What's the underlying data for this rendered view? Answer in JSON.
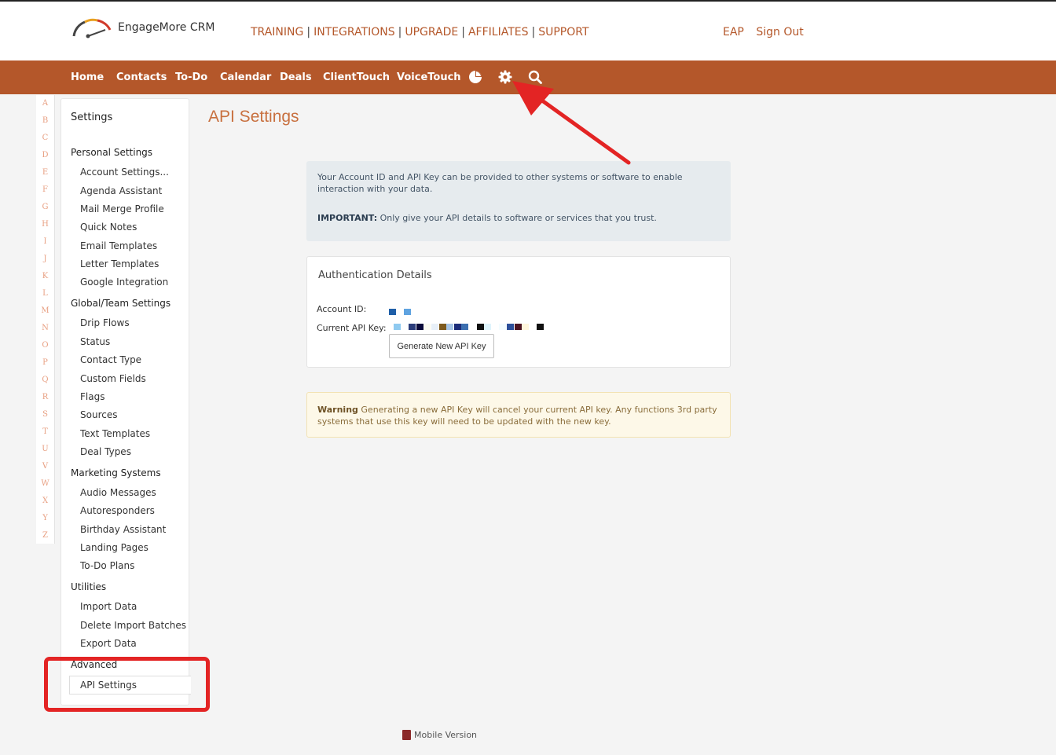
{
  "brand": {
    "name": "EngageMore CRM",
    "logo_icon": "speedometer-logo-icon"
  },
  "top_links": [
    "TRAINING",
    "INTEGRATIONS",
    "UPGRADE",
    "AFFILIATES",
    "SUPPORT"
  ],
  "user": {
    "initials": "EAP",
    "sign_out": "Sign Out"
  },
  "nav": {
    "items": [
      "Home",
      "Contacts",
      "To-Do",
      "Calendar",
      "Deals",
      "ClientTouch",
      "VoiceTouch"
    ],
    "icons": [
      "pie-chart-icon",
      "gear-icon",
      "search-icon"
    ]
  },
  "alphabet": [
    "A",
    "B",
    "C",
    "D",
    "E",
    "F",
    "G",
    "H",
    "I",
    "J",
    "K",
    "L",
    "M",
    "N",
    "O",
    "P",
    "Q",
    "R",
    "S",
    "T",
    "U",
    "V",
    "W",
    "X",
    "Y",
    "Z"
  ],
  "sidebar": {
    "title": "Settings",
    "sections": [
      {
        "heading": "Personal Settings",
        "items": [
          "Account Settings...",
          "Agenda Assistant",
          "Mail Merge Profile",
          "Quick Notes",
          "Email Templates",
          "Letter Templates",
          "Google Integration"
        ]
      },
      {
        "heading": "Global/Team Settings",
        "items": [
          "Drip Flows",
          "Status",
          "Contact Type",
          "Custom Fields",
          "Flags",
          "Sources",
          "Text Templates",
          "Deal Types"
        ]
      },
      {
        "heading": "Marketing Systems",
        "items": [
          "Audio Messages",
          "Autoresponders",
          "Birthday Assistant",
          "Landing Pages",
          "To-Do Plans"
        ]
      },
      {
        "heading": "Utilities",
        "items": [
          "Import Data",
          "Delete Import Batches",
          "Export Data"
        ]
      },
      {
        "heading": "Advanced",
        "items": [
          "API Settings"
        ]
      }
    ],
    "active_item": "API Settings"
  },
  "page": {
    "title": "API Settings",
    "info": {
      "text": "Your Account ID and API Key can be provided to other systems or software to enable interaction with your data.",
      "important_label": "IMPORTANT:",
      "important_text": " Only give your API details to software or services that you trust."
    },
    "auth": {
      "title": "Authentication Details",
      "account_id_label": "Account ID:",
      "api_key_label": "Current API Key:",
      "generate_button": "Generate New API Key",
      "redacted_colors": {
        "account_id": [
          "#1f5fa8",
          "#5fa3e0"
        ],
        "api_key": [
          "#8fcaf0",
          "#ffffff",
          "#2a3c7a",
          "#0a0a3a",
          "#fafaf0",
          "#e8f0f8",
          "#7d5a1e",
          "#a7c6e8",
          "#1b2c7a",
          "#3c6fb0",
          "#ffffff",
          "#111111",
          "#dff4fc",
          "#ffffff",
          "#f4fcff",
          "#2b4f9a",
          "#4a1320",
          "#fff6dc",
          "#ffffff",
          "#111111"
        ]
      }
    },
    "warning": {
      "label": "Warning",
      "text": " Generating a new API Key will cancel your current API key. Any functions 3rd party systems that use this key will need to be updated with the new key."
    }
  },
  "footer": {
    "mobile_version": "Mobile Version"
  },
  "colors": {
    "brand": "#b4572a",
    "title": "#c8703f",
    "annotation": "#e32424",
    "info_bg": "#e6ebee",
    "warning_bg": "#fdf8e8"
  }
}
